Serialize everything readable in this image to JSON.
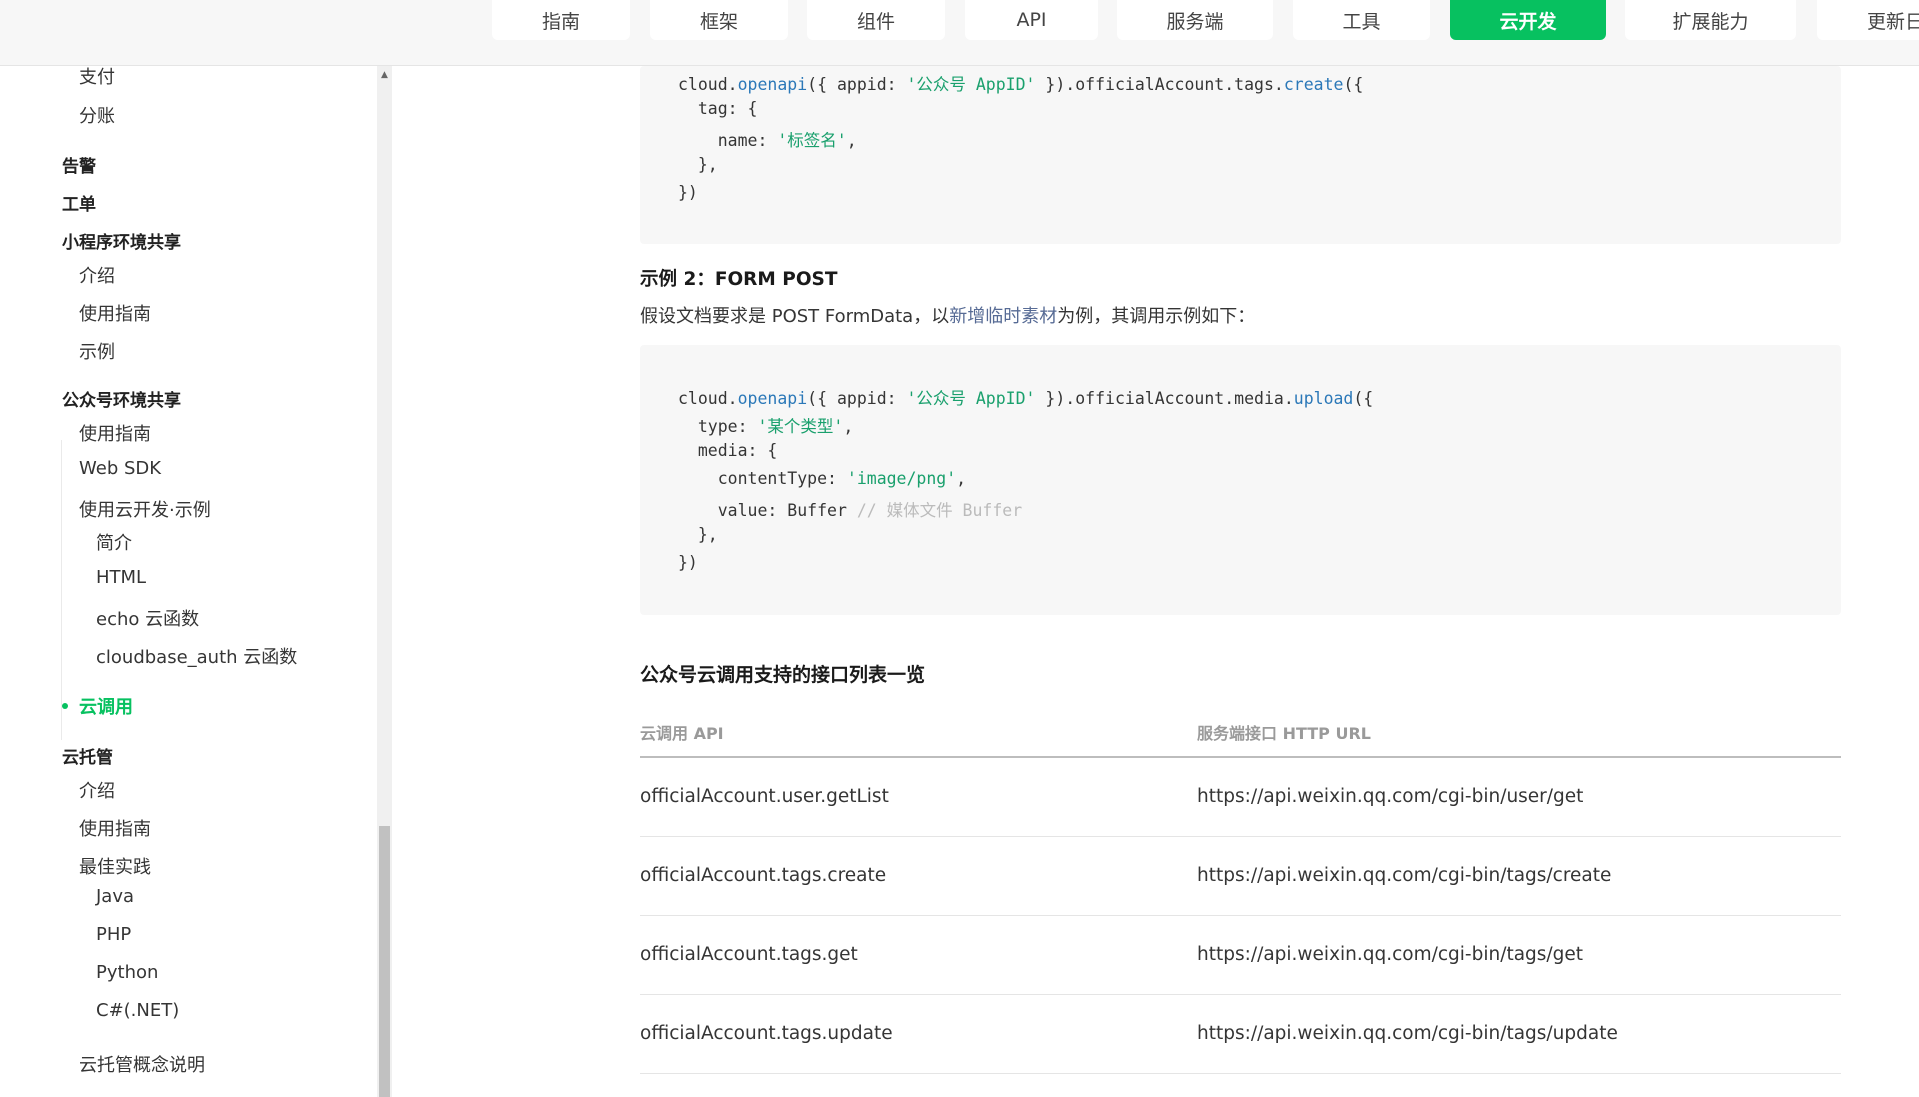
{
  "nav": {
    "tabs": [
      {
        "label": "指南",
        "active": false
      },
      {
        "label": "框架",
        "active": false
      },
      {
        "label": "组件",
        "active": false
      },
      {
        "label": "API",
        "active": false
      },
      {
        "label": "服务端",
        "active": false
      },
      {
        "label": "工具",
        "active": false
      },
      {
        "label": "云开发",
        "active": true
      },
      {
        "label": "扩展能力",
        "active": false
      },
      {
        "label": "更新日",
        "active": false
      }
    ]
  },
  "sidebar": {
    "items": [
      {
        "label": "支付"
      },
      {
        "label": "分账"
      },
      {
        "label": "告警"
      },
      {
        "label": "工单"
      },
      {
        "label": "小程序环境共享"
      },
      {
        "label": "介绍"
      },
      {
        "label": "使用指南"
      },
      {
        "label": "示例"
      },
      {
        "label": "公众号环境共享"
      },
      {
        "label": "使用指南"
      },
      {
        "label": "Web SDK"
      },
      {
        "label": "使用云开发·示例"
      },
      {
        "label": "简介"
      },
      {
        "label": "HTML"
      },
      {
        "label": "echo 云函数"
      },
      {
        "label": "cloudbase_auth 云函数"
      },
      {
        "label": "云调用"
      },
      {
        "label": "云托管"
      },
      {
        "label": "介绍"
      },
      {
        "label": "使用指南"
      },
      {
        "label": "最佳实践"
      },
      {
        "label": "Java"
      },
      {
        "label": "PHP"
      },
      {
        "label": "Python"
      },
      {
        "label": "C#(.NET)"
      },
      {
        "label": "云托管概念说明"
      }
    ]
  },
  "content": {
    "code1": {
      "l1_a": "cloud.",
      "l1_fn": "openapi",
      "l1_b": "({ appid: ",
      "l1_str": "'公众号 AppID'",
      "l1_c": " }).officialAccount.tags.",
      "l1_fn2": "create",
      "l1_d": "({",
      "l2": "  tag: {",
      "l3_a": "    name: ",
      "l3_str": "'标签名'",
      "l3_b": ",",
      "l4": "  },",
      "l5": "})"
    },
    "example2_title": "示例 2：FORM POST",
    "example2_desc_a": "假设文档要求是 POST FormData，以",
    "example2_desc_link": "新增临时素材",
    "example2_desc_b": "为例，其调用示例如下：",
    "code2": {
      "l1_a": "cloud.",
      "l1_fn": "openapi",
      "l1_b": "({ appid: ",
      "l1_str": "'公众号 AppID'",
      "l1_c": " }).officialAccount.media.",
      "l1_fn2": "upload",
      "l1_d": "({",
      "l2_a": "  type: ",
      "l2_str": "'某个类型'",
      "l2_b": ",",
      "l3": "  media: {",
      "l4_a": "    contentType: ",
      "l4_str": "'image/png'",
      "l4_b": ",",
      "l5_a": "    value: Buffer ",
      "l5_cmt": "// 媒体文件 Buffer",
      "l6": "  },",
      "l7": "})"
    },
    "table_title": "公众号云调用支持的接口列表一览",
    "table": {
      "headers": [
        "云调用 API",
        "服务端接口 HTTP URL"
      ],
      "rows": [
        [
          "officialAccount.user.getList",
          "https://api.weixin.qq.com/cgi-bin/user/get"
        ],
        [
          "officialAccount.tags.create",
          "https://api.weixin.qq.com/cgi-bin/tags/create"
        ],
        [
          "officialAccount.tags.get",
          "https://api.weixin.qq.com/cgi-bin/tags/get"
        ],
        [
          "officialAccount.tags.update",
          "https://api.weixin.qq.com/cgi-bin/tags/update"
        ]
      ]
    }
  }
}
